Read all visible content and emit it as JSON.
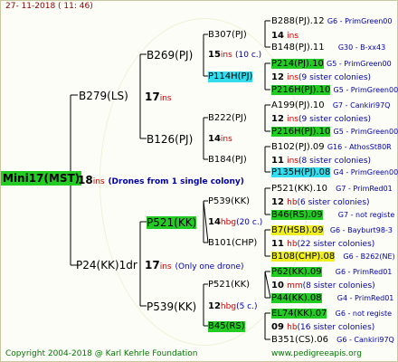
{
  "header": {
    "timestamp": "27-  11-2018  ( 11:  46)"
  },
  "footer": {
    "copyright": "Copyright 2004-2018 @ Karl Kehrle Foundation",
    "site": "www.pedigreeapis.org"
  },
  "root": {
    "name": "Mini17(MST)",
    "count": "18",
    "unit": "ins",
    "note": "(Drones from 1 single colony)"
  },
  "gen1": {
    "upper": {
      "name": "B279(LS)",
      "count": "17",
      "unit": "ins"
    },
    "lower": {
      "name": "P24(KK)1dr",
      "count": "17",
      "unit": "ins",
      "note": "(Only one drone)"
    }
  },
  "gen2": {
    "a": {
      "name": "B269(PJ)",
      "count": "15",
      "unit": "ins",
      "note": "(10 c.)"
    },
    "b": {
      "name": "B126(PJ)",
      "count": "14",
      "unit": "ins"
    },
    "c": {
      "name": "P521(KK)",
      "count": "14",
      "unit": "hbg",
      "note": "(20 c.)"
    },
    "d": {
      "name": "P539(KK)",
      "count": "12",
      "unit": "hbg",
      "note": "(5 c.)"
    }
  },
  "gen3": {
    "a": {
      "name": "B307(PJ)",
      "count": "14",
      "unit": "ins"
    },
    "b": {
      "name": "P114H(PJ)"
    },
    "c": {
      "name": "B222(PJ)",
      "count": "14",
      "unit": "ins"
    },
    "d": {
      "name": "B184(PJ)"
    },
    "e": {
      "name": "P539(KK)"
    },
    "f": {
      "name": "B101(CHP)"
    },
    "g": {
      "name": "P521(KK)"
    },
    "h": {
      "name": "B45(RS)"
    }
  },
  "gen4": [
    {
      "name": "B288(PJ).12",
      "info": "G6 - PrimGreen00"
    },
    {
      "count": "14",
      "unit": "ins"
    },
    {
      "name": "B148(PJ).11",
      "info": "G30 - B-xx43"
    },
    {
      "name": "P214(PJ).10",
      "info": "G5 - PrimGreen00"
    },
    {
      "count": "12",
      "unit": "ins",
      "note": "(9 sister colonies)"
    },
    {
      "name": "P216H(PJ).10",
      "info": "G5 - PrimGreen00"
    },
    {
      "name": "A199(PJ).10",
      "info": "G7 - Cankiri97Q"
    },
    {
      "count": "12",
      "unit": "ins",
      "note": "(9 sister colonies)"
    },
    {
      "name": "P216H(PJ).10",
      "info": "G5 - PrimGreen00"
    },
    {
      "name": "B102(PJ).09",
      "info": "G16 - AthosSt80R"
    },
    {
      "count": "11",
      "unit": "ins",
      "note": "(8 sister colonies)"
    },
    {
      "name": "P135H(PJ).08",
      "info": "G4 - PrimGreen00"
    },
    {
      "name": "P521(KK).10",
      "info": "G7 - PrimRed01"
    },
    {
      "count": "12",
      "unit": "hb",
      "note": "(6 sister colonies)"
    },
    {
      "name": "B46(RS).09",
      "info": "G7 - not registe"
    },
    {
      "name": "B7(HSB).09",
      "info": "G6 - Bayburt98-3"
    },
    {
      "count": "11",
      "unit": "hb",
      "note": "(22 sister colonies)"
    },
    {
      "name": "B108(CHP).08",
      "info": "G6 - B262(NE)"
    },
    {
      "name": "P62(KK).09",
      "info": "G6 - PrimRed01"
    },
    {
      "count": "10",
      "unit": "mm",
      "note": "(8 sister colonies)"
    },
    {
      "name": "P44(KK).08",
      "info": "G4 - PrimRed01"
    },
    {
      "name": "EL74(KK).07",
      "info": "G6 - not registe"
    },
    {
      "count": "09",
      "unit": "hb",
      "note": "(16 sister colonies)"
    },
    {
      "name": "B351(CS).06",
      "info": "G6 - Cankiri97Q"
    }
  ]
}
